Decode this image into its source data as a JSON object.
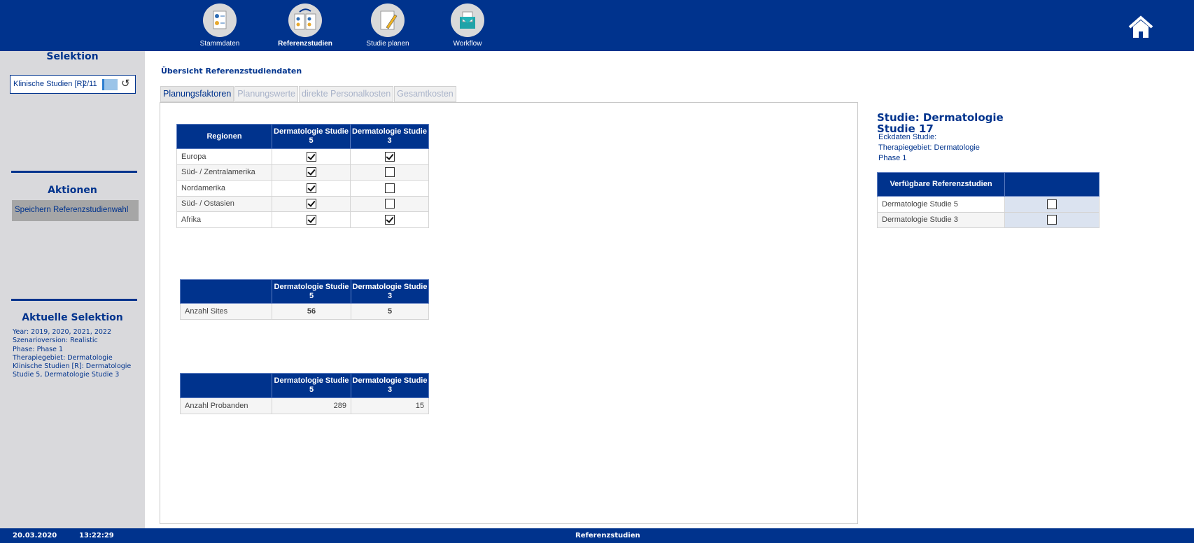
{
  "nav": {
    "items": [
      {
        "label": "Stammdaten",
        "icon": "stammdaten-icon"
      },
      {
        "label": "Referenzstudien",
        "icon": "referenzstudien-icon",
        "active": true
      },
      {
        "label": "Studie planen",
        "icon": "studie-planen-icon"
      },
      {
        "label": "Workflow",
        "icon": "workflow-icon"
      }
    ],
    "home_icon": "home-icon"
  },
  "sidebar": {
    "selektion_title": "Selektion",
    "selektion_field": "Klinische Studien [R]",
    "selektion_count": "2/11",
    "aktionen_title": "Aktionen",
    "save_button": "Speichern Referenzstudienwahl",
    "aktuelle_title": "Aktuelle Selektion",
    "aktuelle_lines": [
      "Year: 2019, 2020, 2021, 2022",
      "Szenarioversion: Realistic",
      "Phase: Phase 1",
      "Therapiegebiet: Dermatologie",
      "Klinische Studien [R]: Dermatologie Studie 5, Dermatologie Studie 3"
    ]
  },
  "main": {
    "title": "Übersicht Referenzstudiendaten",
    "tabs": [
      "Planungsfaktoren",
      "Planungswerte",
      "direkte Personalkosten",
      "Gesamtkosten"
    ],
    "regions_table": {
      "headers": [
        "Regionen",
        "Dermatologie Studie 5",
        "Dermatologie Studie 3"
      ],
      "rows": [
        {
          "label": "Europa",
          "s5": true,
          "s3": true
        },
        {
          "label": "Süd- / Zentralamerika",
          "s5": true,
          "s3": false
        },
        {
          "label": "Nordamerika",
          "s5": true,
          "s3": false
        },
        {
          "label": "Süd- / Ostasien",
          "s5": true,
          "s3": false
        },
        {
          "label": "Afrika",
          "s5": true,
          "s3": true
        }
      ]
    },
    "sites_table": {
      "headers": [
        "",
        "Dermatologie Studie 5",
        "Dermatologie Studie 3"
      ],
      "label": "Anzahl Sites",
      "s5": "56",
      "s3": "5"
    },
    "probanden_table": {
      "headers": [
        "",
        "Dermatologie Studie 5",
        "Dermatologie Studie 3"
      ],
      "label": "Anzahl Probanden",
      "s5": "289",
      "s3": "15"
    }
  },
  "right": {
    "title": "Studie: Dermatologie Studie 17",
    "info": [
      "Eckdaten Studie:",
      "Therapiegebiet: Dermatologie",
      "Phase 1"
    ],
    "table_header": "Verfügbare Referenzstudien",
    "rows": [
      {
        "label": "Dermatologie Studie 5",
        "checked": false
      },
      {
        "label": "Dermatologie Studie 3",
        "checked": false
      }
    ]
  },
  "footer": {
    "date": "20.03.2020",
    "time": "13:22:29",
    "page": "Referenzstudien"
  },
  "colors": {
    "primary": "#00338d",
    "sidebar": "#d9d9dc"
  }
}
